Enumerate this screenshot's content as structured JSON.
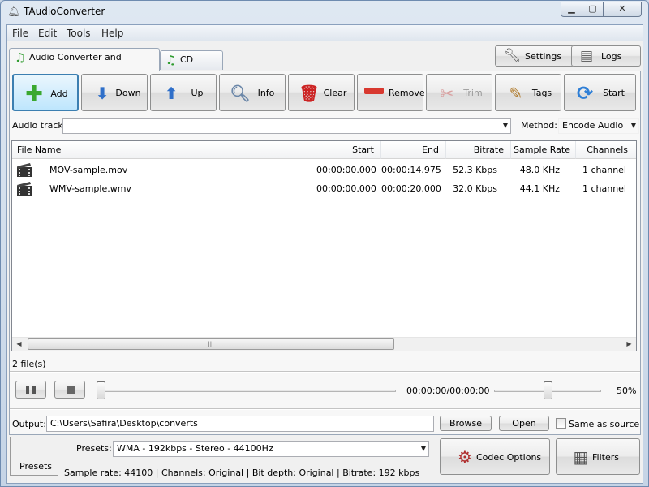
{
  "window": {
    "title": "TAudioConverter",
    "min_glyph": "▁",
    "max_glyph": "▢",
    "close_glyph": "✕"
  },
  "menu": [
    "File",
    "Edit",
    "Tools",
    "Help"
  ],
  "tabs": [
    {
      "label": "Audio Converter and Extractor",
      "icon": "music-note-icon",
      "active": true
    },
    {
      "label": "CD Ripper",
      "icon": "music-note-icon",
      "active": false
    }
  ],
  "top_buttons": {
    "settings": "Settings",
    "logs": "Logs"
  },
  "toolbar": {
    "add": "Add",
    "down": "Down",
    "up": "Up",
    "info": "Info",
    "clear": "Clear",
    "remove": "Remove",
    "trim": "Trim",
    "tags": "Tags",
    "start": "Start"
  },
  "audio_track": {
    "label": "Audio track:",
    "value": ""
  },
  "method": {
    "label": "Method:",
    "value": "Encode Audio"
  },
  "columns": [
    "File Name",
    "Start",
    "End",
    "Bitrate",
    "Sample Rate",
    "Channels"
  ],
  "files": [
    {
      "name": "MOV-sample.mov",
      "start": "00:00:00.000",
      "end": "00:00:14.975",
      "bitrate": "52.3 Kbps",
      "sample_rate": "48.0 KHz",
      "channels": "1 channel"
    },
    {
      "name": "WMV-sample.wmv",
      "start": "00:00:00.000",
      "end": "00:00:20.000",
      "bitrate": "32.0 Kbps",
      "sample_rate": "44.1 KHz",
      "channels": "1 channel"
    }
  ],
  "file_count": "2 file(s)",
  "player": {
    "time": "00:00:00/00:00:00",
    "volume": "50%",
    "position_fraction": 0.0,
    "volume_fraction": 0.5
  },
  "output": {
    "label": "Output:",
    "path": "C:\\Users\\Safira\\Desktop\\converts",
    "browse": "Browse",
    "open": "Open",
    "same_as_source": "Same as source",
    "same_as_source_checked": false
  },
  "presets": {
    "button": "Presets",
    "label": "Presets:",
    "value": "WMA - 192kbps - Stereo - 44100Hz",
    "info": "Sample rate: 44100 | Channels: Original | Bit depth: Original | Bitrate: 192 kbps"
  },
  "bottom_buttons": {
    "codec_options": "Codec Options",
    "filters": "Filters"
  },
  "colors": {
    "accent_blue": "#3c7fb1",
    "add_green": "#3aa830",
    "remove_red": "#d8382f",
    "clear_red": "#cc2222",
    "start_blue": "#2f7fd6"
  }
}
